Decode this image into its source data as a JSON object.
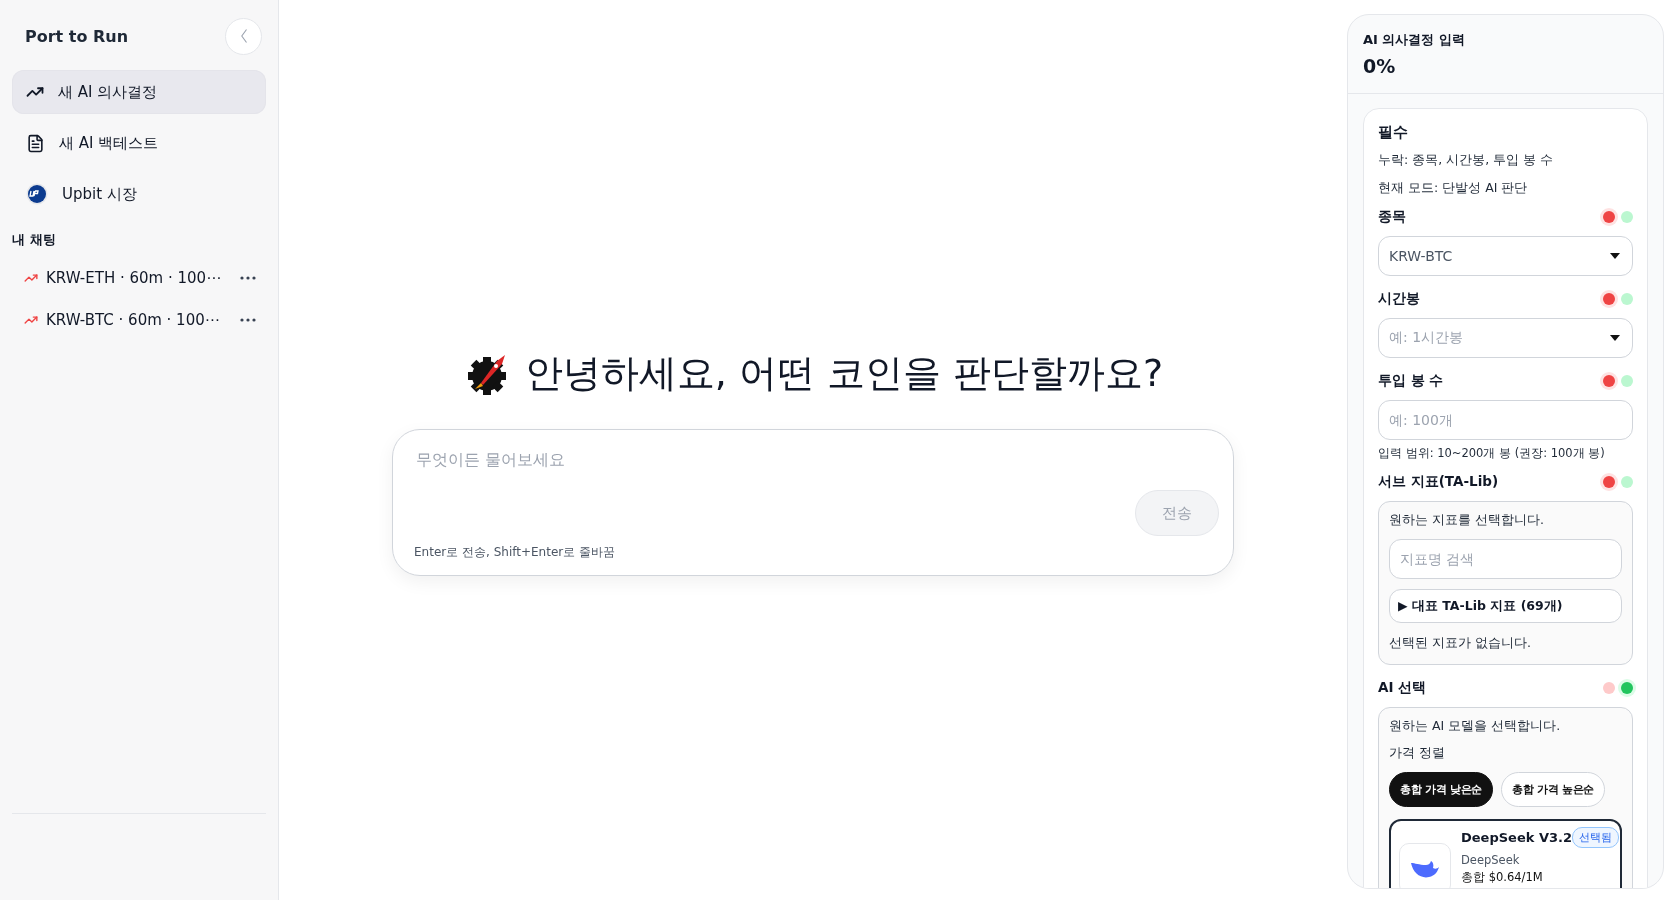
{
  "sidebar": {
    "title": "Port to Run",
    "nav": [
      {
        "kind": "trend",
        "label": "새 AI 의사결정",
        "selected": true
      },
      {
        "kind": "document",
        "label": "새 AI 백테스트",
        "selected": false
      },
      {
        "kind": "upbit",
        "label": "Upbit 시장",
        "selected": false
      }
    ],
    "chats_heading": "내 채팅",
    "chats": [
      {
        "title": "KRW-ETH · 60m · 100⋯"
      },
      {
        "title": "KRW-BTC · 60m · 100⋯"
      }
    ]
  },
  "main": {
    "greeting": "안녕하세요, 어떤 코인을 판단할까요?",
    "input": {
      "placeholder": "무엇이든 물어보세요"
    },
    "send_button": "전송",
    "hint": "Enter로 전송, Shift+Enter로 줄바꿈"
  },
  "panel": {
    "title": "AI 의사결정 입력",
    "progress": "0%",
    "section_title": "필수",
    "missing": "누락: 종목, 시간봉, 투입 봉 수",
    "mode": "현재 모드: 단발성 AI 판단",
    "fields": [
      {
        "kind": "select",
        "label": "종목",
        "complete": false,
        "value": "KRW-BTC"
      },
      {
        "kind": "select",
        "label": "시간봉",
        "complete": false,
        "placeholder": "예: 1시간봉"
      },
      {
        "kind": "input",
        "label": "투입 봉 수",
        "complete": false,
        "placeholder": "예: 100개",
        "help": "입력 범위: 10~200개 봉 (권장: 100개 봉)"
      },
      {
        "kind": "indicators",
        "label": "서브 지표(TA-Lib)",
        "complete": false,
        "description": "원하는 지표를 선택합니다.",
        "search_placeholder": "지표명 검색",
        "toggle": "▶ 대표 TA-Lib 지표 (69개)",
        "empty": "선택된 지표가 없습니다."
      },
      {
        "kind": "models",
        "label": "AI 선택",
        "complete": true,
        "description": "원하는 AI 모델을 선택합니다.",
        "sort_label": "가격 정렬",
        "sorts": [
          {
            "label": "총합 가격 낮은순",
            "selected": true
          },
          {
            "label": "총합 가격 높은순",
            "selected": false
          }
        ],
        "models": [
          {
            "name": "DeepSeek V3.2",
            "provider": "DeepSeek",
            "price": "총합 $0.64/1M",
            "badge": "선택됨",
            "selected": true
          }
        ]
      }
    ]
  }
}
